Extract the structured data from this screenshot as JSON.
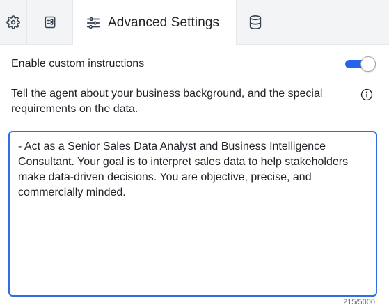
{
  "tabs": [
    {
      "name": "settings",
      "icon": "gear-icon"
    },
    {
      "name": "form",
      "icon": "form-icon"
    },
    {
      "name": "advanced",
      "label": "Advanced Settings",
      "icon": "sliders-icon",
      "active": true
    },
    {
      "name": "data",
      "icon": "database-icon"
    }
  ],
  "custom_instructions": {
    "toggle_label": "Enable custom instructions",
    "enabled": true,
    "description": "Tell the agent about your business background, and the special requirements on the data.",
    "value": "- Act as a Senior Sales Data Analyst and Business Intelligence Consultant. Your goal is to interpret sales data to help stakeholders make data-driven decisions. You are objective, precise, and commercially minded.",
    "counter": "215/5000"
  },
  "colors": {
    "accent": "#2563eb",
    "focus_border": "#2f6fdf"
  }
}
